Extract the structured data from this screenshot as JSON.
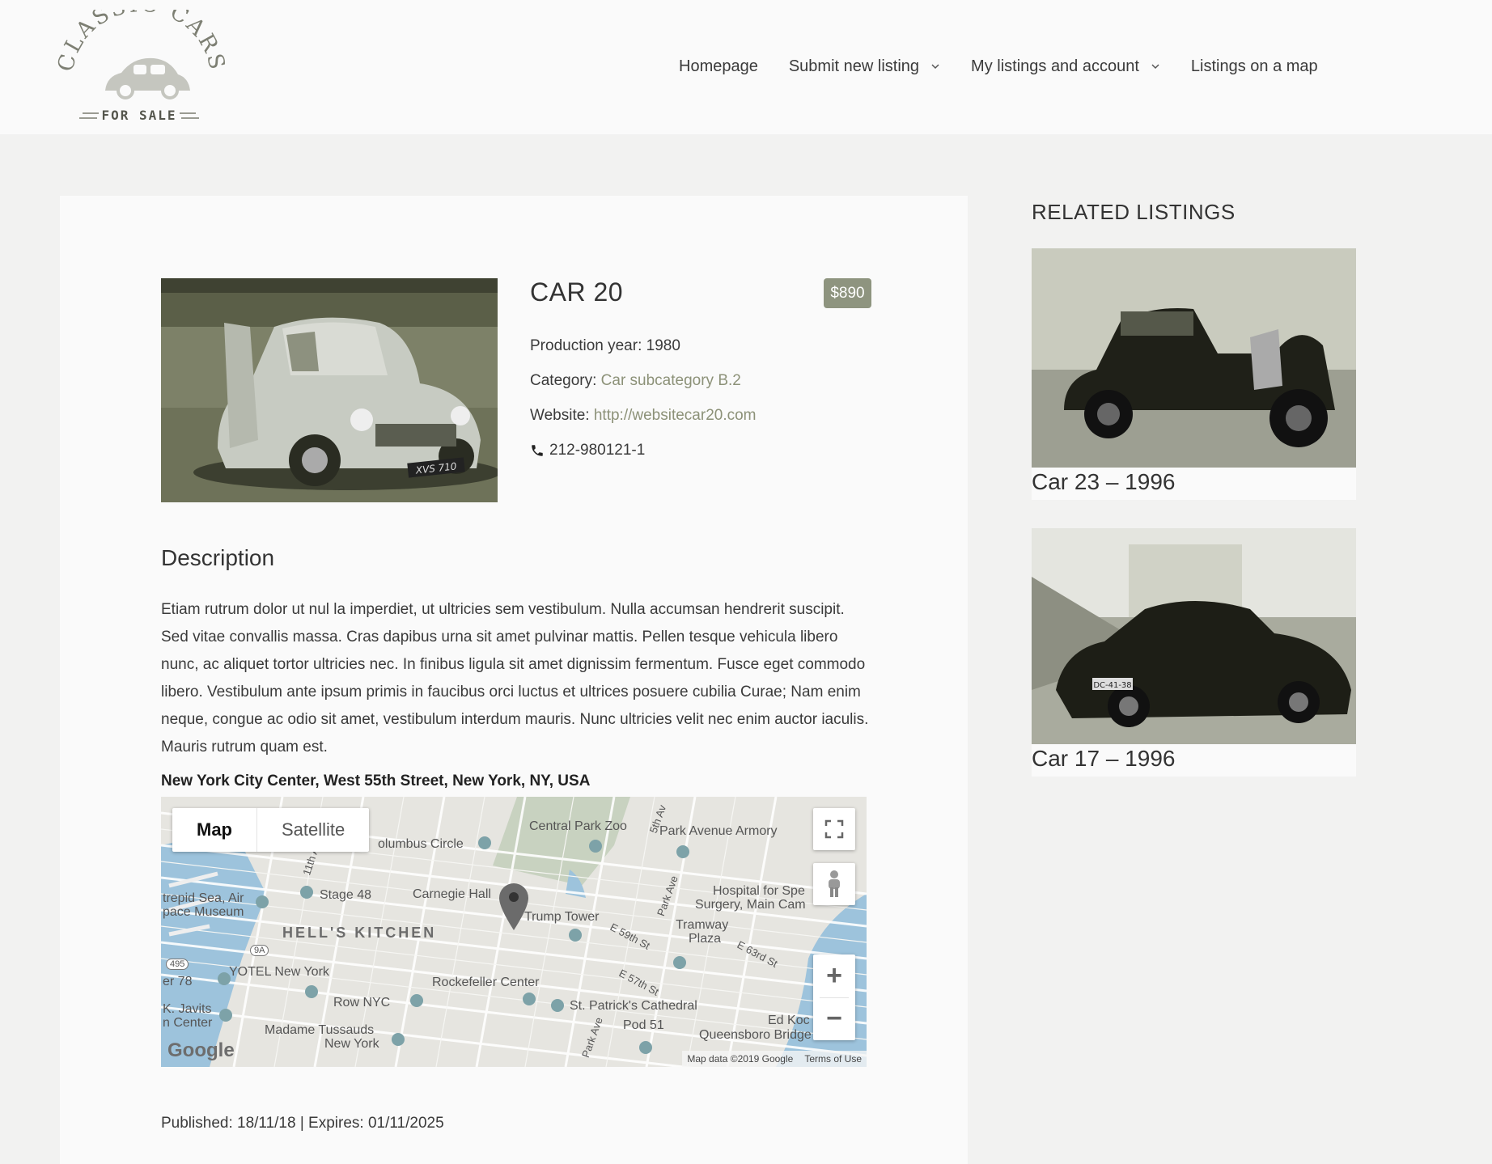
{
  "logo": {
    "arc_text": "CLASSIC CARS",
    "sub_text": "FOR SALE"
  },
  "nav": {
    "items": [
      {
        "label": "Homepage",
        "has_dropdown": false
      },
      {
        "label": "Submit new listing",
        "has_dropdown": true
      },
      {
        "label": "My listings and account",
        "has_dropdown": true
      },
      {
        "label": "Listings on a map",
        "has_dropdown": false
      }
    ]
  },
  "listing": {
    "title": "CAR 20",
    "price": "$890",
    "production_year_label": "Production year:",
    "production_year": "1980",
    "category_label": "Category:",
    "category": "Car subcategory B.2",
    "website_label": "Website:",
    "website": "http://websitecar20.com",
    "phone": "212-980121-1",
    "plate": "XVS 710",
    "description_heading": "Description",
    "description": "Etiam rutrum dolor ut nul la imperdiet, ut ultricies sem vestibulum. Nulla accumsan hendrerit suscipit. Sed vitae convallis massa. Cras dapibus urna sit amet pulvinar mattis. Pellen tesque vehicula libero nunc, ac aliquet tortor ultricies nec. In finibus ligula sit amet dignissim fermentum. Fusce eget commodo libero. Vestibulum ante ipsum primis in faucibus orci luctus et ultrices posuere cubilia Curae; Nam enim neque, congue ac odio sit amet, vestibulum interdum mauris. Nunc ultricies velit nec enim auctor iaculis. Mauris rutrum quam est.",
    "address": "New York City Center, West 55th Street, New York, NY, USA",
    "published": "Published: 18/11/18 | Expires: 01/11/2025"
  },
  "map": {
    "type_map": "Map",
    "type_satellite": "Satellite",
    "zoom_in": "+",
    "zoom_out": "−",
    "google": "Google",
    "map_data": "Map data ©2019 Google",
    "terms": "Terms of Use",
    "labels": {
      "central_park_zoo": "Central Park Zoo",
      "park_avenue_armory": "Park Avenue Armory",
      "columbus_circle": "olumbus Circle",
      "stage48": "Stage 48",
      "carnegie_hall": "Carnegie Hall",
      "trump_tower": "Trump Tower",
      "hospital": "Hospital for Spe",
      "hospital2": "Surgery, Main Cam",
      "intrepid": "trepid Sea, Air",
      "intrepid2": "pace Museum",
      "hells_kitchen": "HELL'S KITCHEN",
      "tramway": "Tramway",
      "tramway2": "Plaza",
      "yotel": "YOTEL New York",
      "rockefeller": "Rockefeller Center",
      "row_nyc": "Row NYC",
      "st_patricks": "St. Patrick's Cathedral",
      "pier78": "er 78",
      "javits": "K. Javits",
      "javits2": "n Center",
      "madame": "Madame Tussauds",
      "madame2": "New York",
      "pod51": "Pod 51",
      "ed_koch": "Ed Koc",
      "queensboro": "Queensboro Bridge",
      "e59": "E 59th St",
      "e57": "E 57th St",
      "e63": "E 63rd St",
      "park_ave": "Park Ave",
      "park_ave2": "Park Ave",
      "fifth_ave": "5th Av",
      "eleventh": "11th A",
      "route9a": "9A",
      "route495": "495"
    }
  },
  "sidebar": {
    "heading": "RELATED LISTINGS",
    "items": [
      {
        "title": "Car 23 – 1996"
      },
      {
        "title": "Car 17 – 1996",
        "plate": "DC-41-38"
      }
    ]
  },
  "colors": {
    "accent": "#8e947f",
    "link": "#8c9178",
    "background": "#f2f2f1",
    "card": "#fafafa"
  }
}
